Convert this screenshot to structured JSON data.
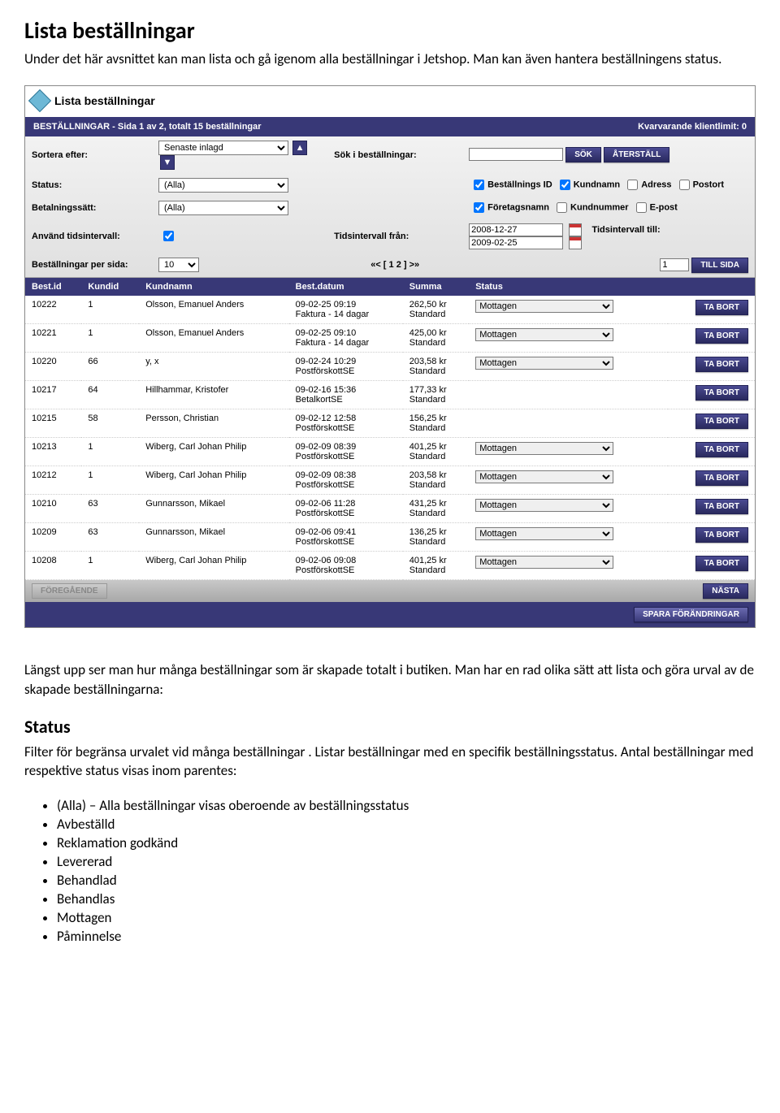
{
  "doc": {
    "h1": "Lista beställningar",
    "intro": "Under det här avsnittet kan man lista och gå igenom alla beställningar i Jetshop. Man kan även hantera beställningens status.",
    "para2": "Längst upp ser man hur många beställningar som är skapade totalt i butiken. Man har en rad olika sätt att lista och göra urval av de skapade beställningarna:",
    "status_h": "Status",
    "status_p": "Filter för begränsa urvalet vid många beställningar . Listar beställningar med en specifik beställningsstatus. Antal beställningar med respektive status visas inom parentes:",
    "bullets": [
      "(Alla) – Alla beställningar visas oberoende av beställningsstatus",
      "Avbeställd",
      "Reklamation godkänd",
      "Levererad",
      "Behandlad",
      "Behandlas",
      "Mottagen",
      "Påminnelse"
    ]
  },
  "shot": {
    "heading": "Lista beställningar",
    "bar_left": "BESTÄLLNINGAR - Sida 1 av 2, totalt 15 beställningar",
    "bar_right": "Kvarvarande klientlimit: 0",
    "labels": {
      "sort": "Sortera efter:",
      "status": "Status:",
      "payment": "Betalningssätt:",
      "interval": "Använd tidsintervall:",
      "perpage": "Beställningar per sida:",
      "search": "Sök i beställningar:",
      "from": "Tidsintervall från:",
      "to": "Tidsintervall till:"
    },
    "values": {
      "sort": "Senaste inlagd",
      "status": "(Alla)",
      "payment": "(Alla)",
      "perpage": "10",
      "from": "2008-12-27",
      "to": "2009-02-25",
      "page_input": "1"
    },
    "buttons": {
      "sok": "SÖK",
      "reset": "ÅTERSTÄLL",
      "tabort": "TA BORT",
      "tillsida": "TILL SIDA",
      "prev": "FÖREGÅENDE",
      "next": "NÄSTA",
      "save": "SPARA FÖRÄNDRINGAR"
    },
    "checks": {
      "bestid": "Beställnings ID",
      "kundnamn": "Kundnamn",
      "adress": "Adress",
      "postort": "Postort",
      "foretag": "Företagsnamn",
      "kundnr": "Kundnummer",
      "epost": "E-post"
    },
    "pager": "«< [ 1 2 ] >»",
    "status_val": "Mottagen",
    "columns": [
      "Best.id",
      "Kundid",
      "Kundnamn",
      "Best.datum",
      "Summa",
      "Status"
    ],
    "rows": [
      {
        "id": "10222",
        "kid": "1",
        "name": "Olsson, Emanuel Anders",
        "date": "09-02-25 09:19",
        "sub": "Faktura - 14 dagar",
        "sum": "262,50 kr",
        "sumsub": "Standard",
        "hasSelect": true
      },
      {
        "id": "10221",
        "kid": "1",
        "name": "Olsson, Emanuel Anders",
        "date": "09-02-25 09:10",
        "sub": "Faktura - 14 dagar",
        "sum": "425,00 kr",
        "sumsub": "Standard",
        "hasSelect": true
      },
      {
        "id": "10220",
        "kid": "66",
        "name": "y, x",
        "date": "09-02-24 10:29",
        "sub": "PostförskottSE",
        "sum": "203,58 kr",
        "sumsub": "Standard",
        "hasSelect": true
      },
      {
        "id": "10217",
        "kid": "64",
        "name": "Hillhammar, Kristofer",
        "date": "09-02-16 15:36",
        "sub": "BetalkortSE",
        "sum": "177,33 kr",
        "sumsub": "Standard",
        "hasSelect": false
      },
      {
        "id": "10215",
        "kid": "58",
        "name": "Persson, Christian",
        "date": "09-02-12 12:58",
        "sub": "PostförskottSE",
        "sum": "156,25 kr",
        "sumsub": "Standard",
        "hasSelect": false
      },
      {
        "id": "10213",
        "kid": "1",
        "name": "Wiberg, Carl Johan Philip",
        "date": "09-02-09 08:39",
        "sub": "PostförskottSE",
        "sum": "401,25 kr",
        "sumsub": "Standard",
        "hasSelect": true
      },
      {
        "id": "10212",
        "kid": "1",
        "name": "Wiberg, Carl Johan Philip",
        "date": "09-02-09 08:38",
        "sub": "PostförskottSE",
        "sum": "203,58 kr",
        "sumsub": "Standard",
        "hasSelect": true
      },
      {
        "id": "10210",
        "kid": "63",
        "name": "Gunnarsson, Mikael",
        "date": "09-02-06 11:28",
        "sub": "PostförskottSE",
        "sum": "431,25 kr",
        "sumsub": "Standard",
        "hasSelect": true
      },
      {
        "id": "10209",
        "kid": "63",
        "name": "Gunnarsson, Mikael",
        "date": "09-02-06 09:41",
        "sub": "PostförskottSE",
        "sum": "136,25 kr",
        "sumsub": "Standard",
        "hasSelect": true
      },
      {
        "id": "10208",
        "kid": "1",
        "name": "Wiberg, Carl Johan Philip",
        "date": "09-02-06 09:08",
        "sub": "PostförskottSE",
        "sum": "401,25 kr",
        "sumsub": "Standard",
        "hasSelect": true
      }
    ]
  }
}
